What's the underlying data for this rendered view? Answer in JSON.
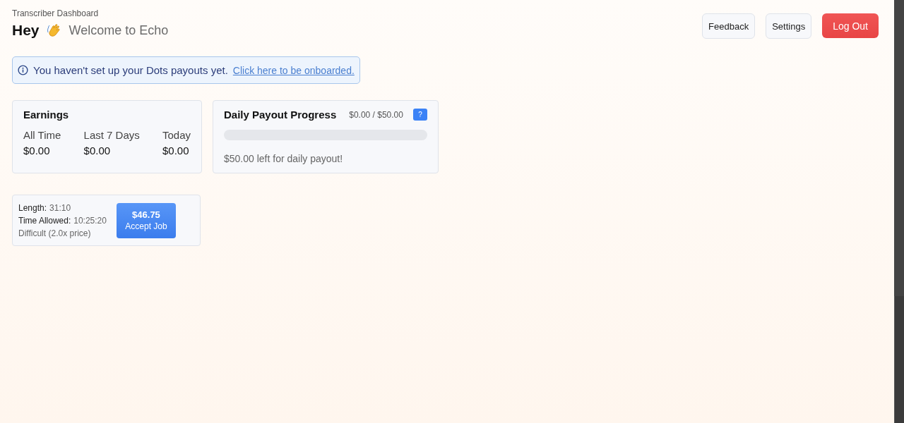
{
  "header": {
    "subtitle": "Transcriber Dashboard",
    "greeting": "Hey",
    "welcome": "Welcome to Echo"
  },
  "nav_buttons": [
    {
      "label": "Feedback",
      "kind": "plain"
    },
    {
      "label": "Settings",
      "kind": "plain"
    },
    {
      "label": "Log Out",
      "kind": "danger"
    }
  ],
  "notice": {
    "text": "You haven't set up your Dots payouts yet.",
    "link": "Click here to be onboarded."
  },
  "earnings": {
    "title": "Earnings",
    "columns": [
      {
        "label": "All Time",
        "value": "$0.00"
      },
      {
        "label": "Last 7 Days",
        "value": "$0.00"
      },
      {
        "label": "Today",
        "value": "$0.00"
      }
    ]
  },
  "payout": {
    "title": "Daily Payout Progress",
    "amount": "$0.00 / $50.00",
    "help": "?",
    "level": 0,
    "message": "$50.00 left for daily payout!"
  },
  "jobs": [
    {
      "length_label": "Length:",
      "length": "31:10",
      "time_label": "Time Allowed:",
      "time": "10:25:20",
      "difficulty": "Difficult (2.0x price)",
      "price": "$46.75",
      "action": "Accept Job"
    }
  ]
}
